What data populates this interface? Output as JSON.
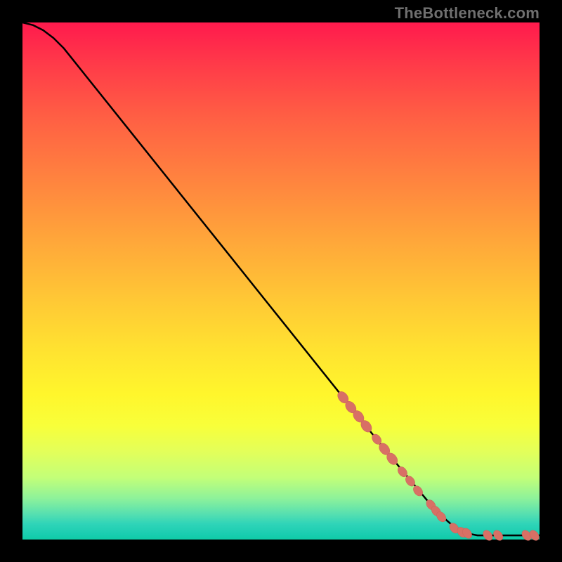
{
  "watermark": "TheBottleneck.com",
  "colors": {
    "frame_background": "#000000",
    "curve_stroke": "#000000",
    "marker_fill": "#d87065",
    "watermark_text": "#6f6f6f",
    "gradient_top": "#ff1a4d",
    "gradient_mid": "#ffe430",
    "gradient_bottom": "#0fcca6"
  },
  "chart_data": {
    "type": "line",
    "title": "",
    "xlabel": "",
    "ylabel": "",
    "xlim": [
      0,
      100
    ],
    "ylim": [
      0,
      100
    ],
    "grid": false,
    "legend": false,
    "curve": [
      {
        "x": 0,
        "y": 100
      },
      {
        "x": 2,
        "y": 99.5
      },
      {
        "x": 4,
        "y": 98.5
      },
      {
        "x": 6,
        "y": 97
      },
      {
        "x": 8,
        "y": 95
      },
      {
        "x": 10,
        "y": 92.5
      },
      {
        "x": 12,
        "y": 90
      },
      {
        "x": 20,
        "y": 80
      },
      {
        "x": 30,
        "y": 67.5
      },
      {
        "x": 40,
        "y": 55
      },
      {
        "x": 50,
        "y": 42.5
      },
      {
        "x": 60,
        "y": 30
      },
      {
        "x": 70,
        "y": 17.5
      },
      {
        "x": 80,
        "y": 5.5
      },
      {
        "x": 84,
        "y": 2
      },
      {
        "x": 86,
        "y": 1.2
      },
      {
        "x": 88,
        "y": 0.8
      },
      {
        "x": 90,
        "y": 0.8
      },
      {
        "x": 94,
        "y": 0.8
      },
      {
        "x": 100,
        "y": 0.8
      }
    ],
    "markers": [
      {
        "x": 62,
        "y": 27.5,
        "r": 8
      },
      {
        "x": 63.5,
        "y": 25.6,
        "r": 8
      },
      {
        "x": 65,
        "y": 23.8,
        "r": 8
      },
      {
        "x": 66.5,
        "y": 21.9,
        "r": 8
      },
      {
        "x": 68.5,
        "y": 19.4,
        "r": 7
      },
      {
        "x": 70,
        "y": 17.5,
        "r": 8
      },
      {
        "x": 71.5,
        "y": 15.6,
        "r": 8
      },
      {
        "x": 73.5,
        "y": 13.1,
        "r": 7
      },
      {
        "x": 75,
        "y": 11.3,
        "r": 7
      },
      {
        "x": 76.5,
        "y": 9.4,
        "r": 7
      },
      {
        "x": 79,
        "y": 6.7,
        "r": 7
      },
      {
        "x": 80,
        "y": 5.5,
        "r": 7
      },
      {
        "x": 81,
        "y": 4.4,
        "r": 7
      },
      {
        "x": 83.5,
        "y": 2.2,
        "r": 7
      },
      {
        "x": 85,
        "y": 1.4,
        "r": 7
      },
      {
        "x": 86,
        "y": 1.2,
        "r": 7
      },
      {
        "x": 90,
        "y": 0.8,
        "r": 7
      },
      {
        "x": 92,
        "y": 0.8,
        "r": 7
      },
      {
        "x": 97.5,
        "y": 0.8,
        "r": 7
      },
      {
        "x": 99,
        "y": 0.8,
        "r": 7
      }
    ]
  }
}
